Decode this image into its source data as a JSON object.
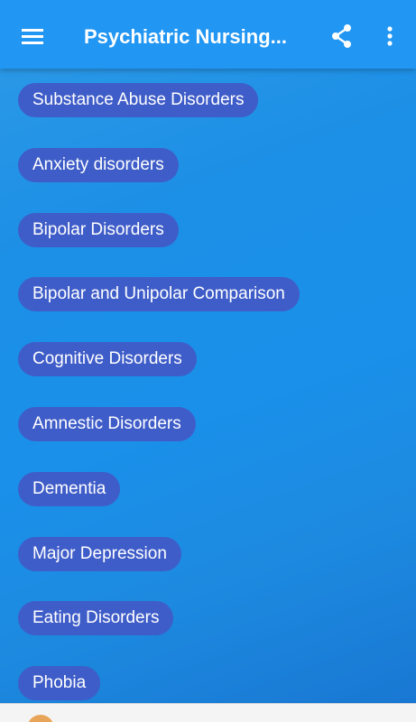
{
  "toolbar": {
    "title": "Psychiatric Nursing...",
    "menu_icon": "menu-icon",
    "share_icon": "share-icon",
    "more_icon": "more-vert-icon"
  },
  "topics": [
    {
      "label": "Substance Abuse Disorders"
    },
    {
      "label": "Anxiety disorders"
    },
    {
      "label": "Bipolar Disorders"
    },
    {
      "label": "Bipolar and Unipolar Comparison"
    },
    {
      "label": "Cognitive Disorders"
    },
    {
      "label": "Amnestic Disorders"
    },
    {
      "label": "Dementia"
    },
    {
      "label": "Major Depression"
    },
    {
      "label": "Eating Disorders"
    },
    {
      "label": "Phobia"
    }
  ],
  "colors": {
    "toolbar": "#2196f3",
    "chip": "#3f5dc8",
    "background": "#1a90ea"
  }
}
